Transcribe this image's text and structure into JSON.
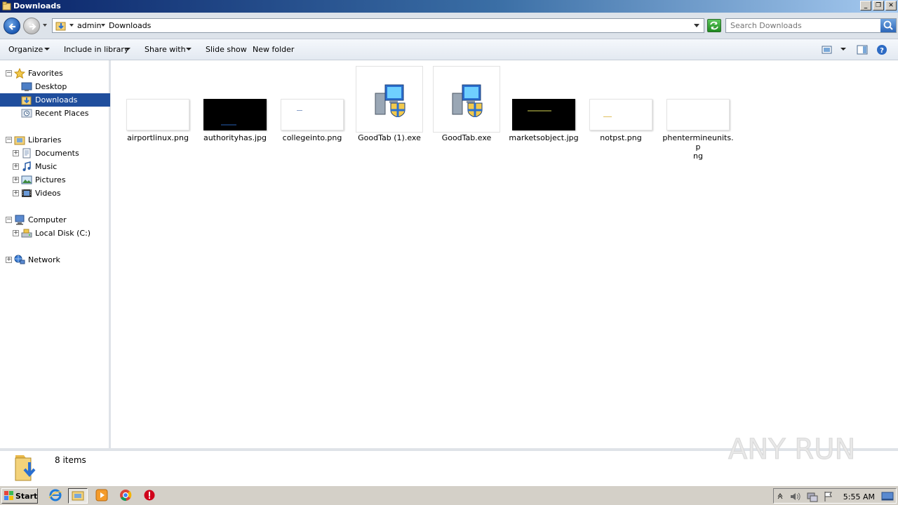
{
  "window": {
    "title": "Downloads",
    "controls": [
      "minimize",
      "restore",
      "close"
    ]
  },
  "address": {
    "crumbs": [
      "admin",
      "Downloads"
    ]
  },
  "search": {
    "placeholder": "Search Downloads"
  },
  "toolbar": {
    "organize": "Organize",
    "include_in_library": "Include in library",
    "share_with": "Share with",
    "slide_show": "Slide show",
    "new_folder": "New folder"
  },
  "nav": {
    "favorites": {
      "label": "Favorites",
      "items": [
        {
          "label": "Desktop",
          "icon": "desktop-icon"
        },
        {
          "label": "Downloads",
          "icon": "downloads-folder-icon",
          "selected": true
        },
        {
          "label": "Recent Places",
          "icon": "recent-places-icon"
        }
      ]
    },
    "libraries": {
      "label": "Libraries",
      "items": [
        {
          "label": "Documents",
          "icon": "documents-icon"
        },
        {
          "label": "Music",
          "icon": "music-icon"
        },
        {
          "label": "Pictures",
          "icon": "pictures-icon"
        },
        {
          "label": "Videos",
          "icon": "videos-icon"
        }
      ]
    },
    "computer": {
      "label": "Computer",
      "items": [
        {
          "label": "Local Disk (C:)",
          "icon": "local-disk-icon"
        }
      ]
    },
    "network": {
      "label": "Network"
    }
  },
  "files": [
    {
      "name": "airportlinux.png",
      "kind": "image",
      "thumb_bg": "#ffffff",
      "thumb_text": ""
    },
    {
      "name": "authorityhas.jpg",
      "kind": "image",
      "thumb_bg": "#000000",
      "thumb_text": ""
    },
    {
      "name": "collegeinto.png",
      "kind": "image",
      "thumb_bg": "#ffffff",
      "thumb_text": ""
    },
    {
      "name": "GoodTab (1).exe",
      "kind": "installer",
      "icon": "installer-icon"
    },
    {
      "name": "GoodTab.exe",
      "kind": "installer",
      "icon": "installer-icon"
    },
    {
      "name": "marketsobject.jpg",
      "kind": "image",
      "thumb_bg": "#000000",
      "thumb_text": ""
    },
    {
      "name": "notpst.png",
      "kind": "image",
      "thumb_bg": "#ffffff",
      "thumb_text": ""
    },
    {
      "name": "phentermineunits.p\nng",
      "kind": "image",
      "thumb_bg": "#ffffff",
      "thumb_text": ""
    }
  ],
  "status": {
    "item_count": "8 items"
  },
  "taskbar": {
    "start_label": "Start",
    "apps": [
      "internet-explorer-icon",
      "windows-explorer-icon",
      "media-player-icon",
      "chrome-icon",
      "stop-icon"
    ],
    "clock": "5:55 AM"
  },
  "watermark": {
    "text": "ANY RUN"
  },
  "colors": {
    "selection": "#1f4e9d",
    "titlebar_start": "#0a246a",
    "titlebar_end": "#a6caf0"
  }
}
